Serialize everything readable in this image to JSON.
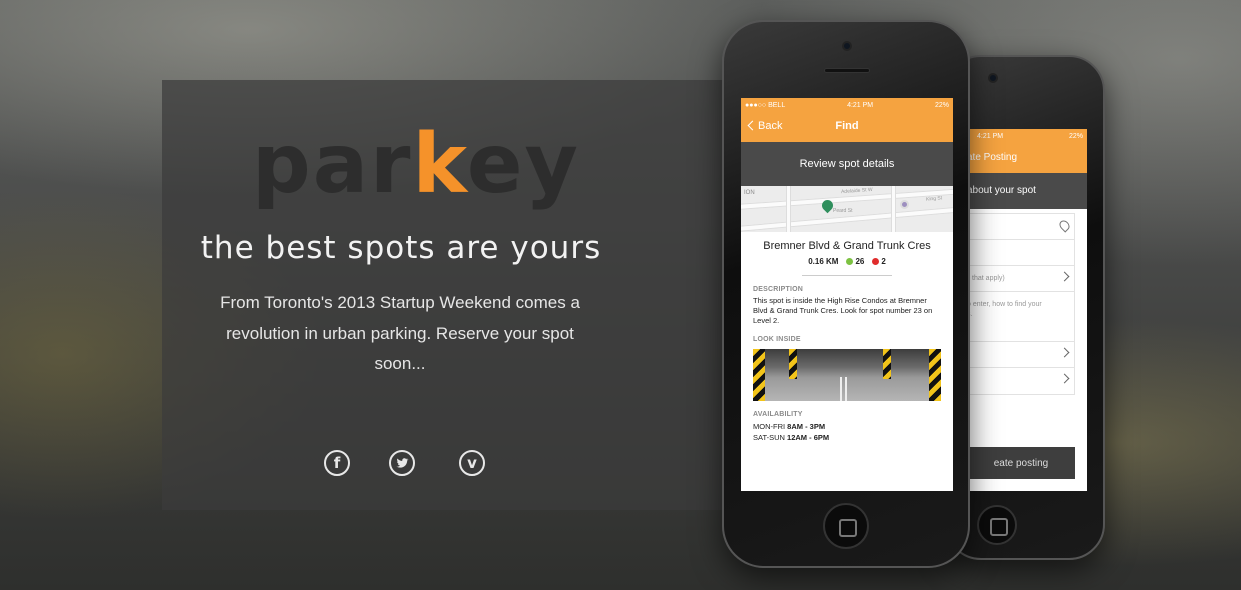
{
  "brand": {
    "logo_part1": "par",
    "logo_accent": "k",
    "logo_part2": "ey",
    "accent_color": "#f5922a"
  },
  "hero": {
    "tagline": "the best spots are yours",
    "description": "From Toronto's 2013 Startup Weekend comes a revolution in urban parking. Reserve your spot soon..."
  },
  "social": [
    {
      "name": "facebook-icon",
      "glyph": "f"
    },
    {
      "name": "twitter-icon",
      "glyph": "bird"
    },
    {
      "name": "vimeo-icon",
      "glyph": "v"
    }
  ],
  "phone_front": {
    "status": {
      "carrier": "●●●○○ BELL",
      "time": "4:21 PM",
      "battery": "22%"
    },
    "nav": {
      "back_label": "Back",
      "title": "Find"
    },
    "section_title": "Review spot details",
    "map_labels": {
      "street1": "Adelaide St W",
      "street2": "King St",
      "street3": "Peard St",
      "corner": "ION"
    },
    "spot": {
      "title": "Bremner Blvd & Grand Trunk Cres",
      "distance": "0.16 KM",
      "available": "26",
      "taken": "2"
    },
    "description_label": "DESCRIPTION",
    "description_text": "This spot is inside the High Rise Condos at Bremner Blvd & Grand Trunk Cres. Look for spot number 23 on Level 2.",
    "look_inside_label": "LOOK INSIDE",
    "availability_label": "AVAILABILITY",
    "availability": [
      {
        "days": "MON-FRI",
        "hours": "8AM - 3PM"
      },
      {
        "days": "SAT-SUN",
        "hours": "12AM - 6PM"
      }
    ],
    "colors": {
      "available": "#7dc242",
      "taken": "#e02c2c"
    }
  },
  "phone_back": {
    "status": {
      "time": "4:21 PM",
      "battery": "22%"
    },
    "nav_title": "ate Posting",
    "section_title": "about your spot",
    "field_hint1": "ll that apply)",
    "field_hint2": "o enter, how to find your",
    "field_hint3": "s.",
    "button_label": "eate posting"
  }
}
